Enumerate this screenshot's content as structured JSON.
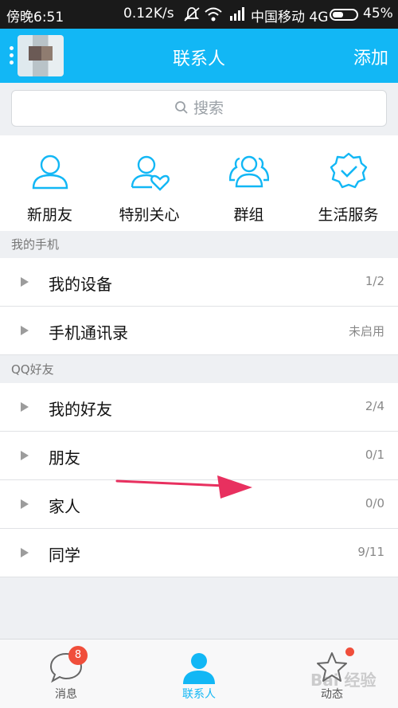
{
  "status_bar": {
    "time": "傍晚6:51",
    "speed": "0.12K/s",
    "carrier": "中国移动 4G",
    "battery": "45%"
  },
  "header": {
    "title": "联系人",
    "add_label": "添加"
  },
  "search": {
    "placeholder": "搜索"
  },
  "quick_actions": [
    {
      "label": "新朋友",
      "icon": "person-icon"
    },
    {
      "label": "特别关心",
      "icon": "person-heart-icon"
    },
    {
      "label": "群组",
      "icon": "group-icon"
    },
    {
      "label": "生活服务",
      "icon": "verified-badge-icon"
    }
  ],
  "sections": [
    {
      "title": "我的手机",
      "rows": [
        {
          "name": "我的设备",
          "count": "1/2"
        },
        {
          "name": "手机通讯录",
          "count": "未启用"
        }
      ]
    },
    {
      "title": "QQ好友",
      "rows": [
        {
          "name": "我的好友",
          "count": "2/4"
        },
        {
          "name": "朋友",
          "count": "0/1"
        },
        {
          "name": "家人",
          "count": "0/0"
        },
        {
          "name": "同学",
          "count": "9/11"
        }
      ]
    }
  ],
  "tabs": [
    {
      "label": "消息",
      "badge": "8"
    },
    {
      "label": "联系人"
    },
    {
      "label": "动态"
    }
  ],
  "watermark": "Bai 经验",
  "colors": {
    "accent": "#12b7f5",
    "badge": "#f04e3b",
    "annotation_arrow": "#e8305f"
  }
}
